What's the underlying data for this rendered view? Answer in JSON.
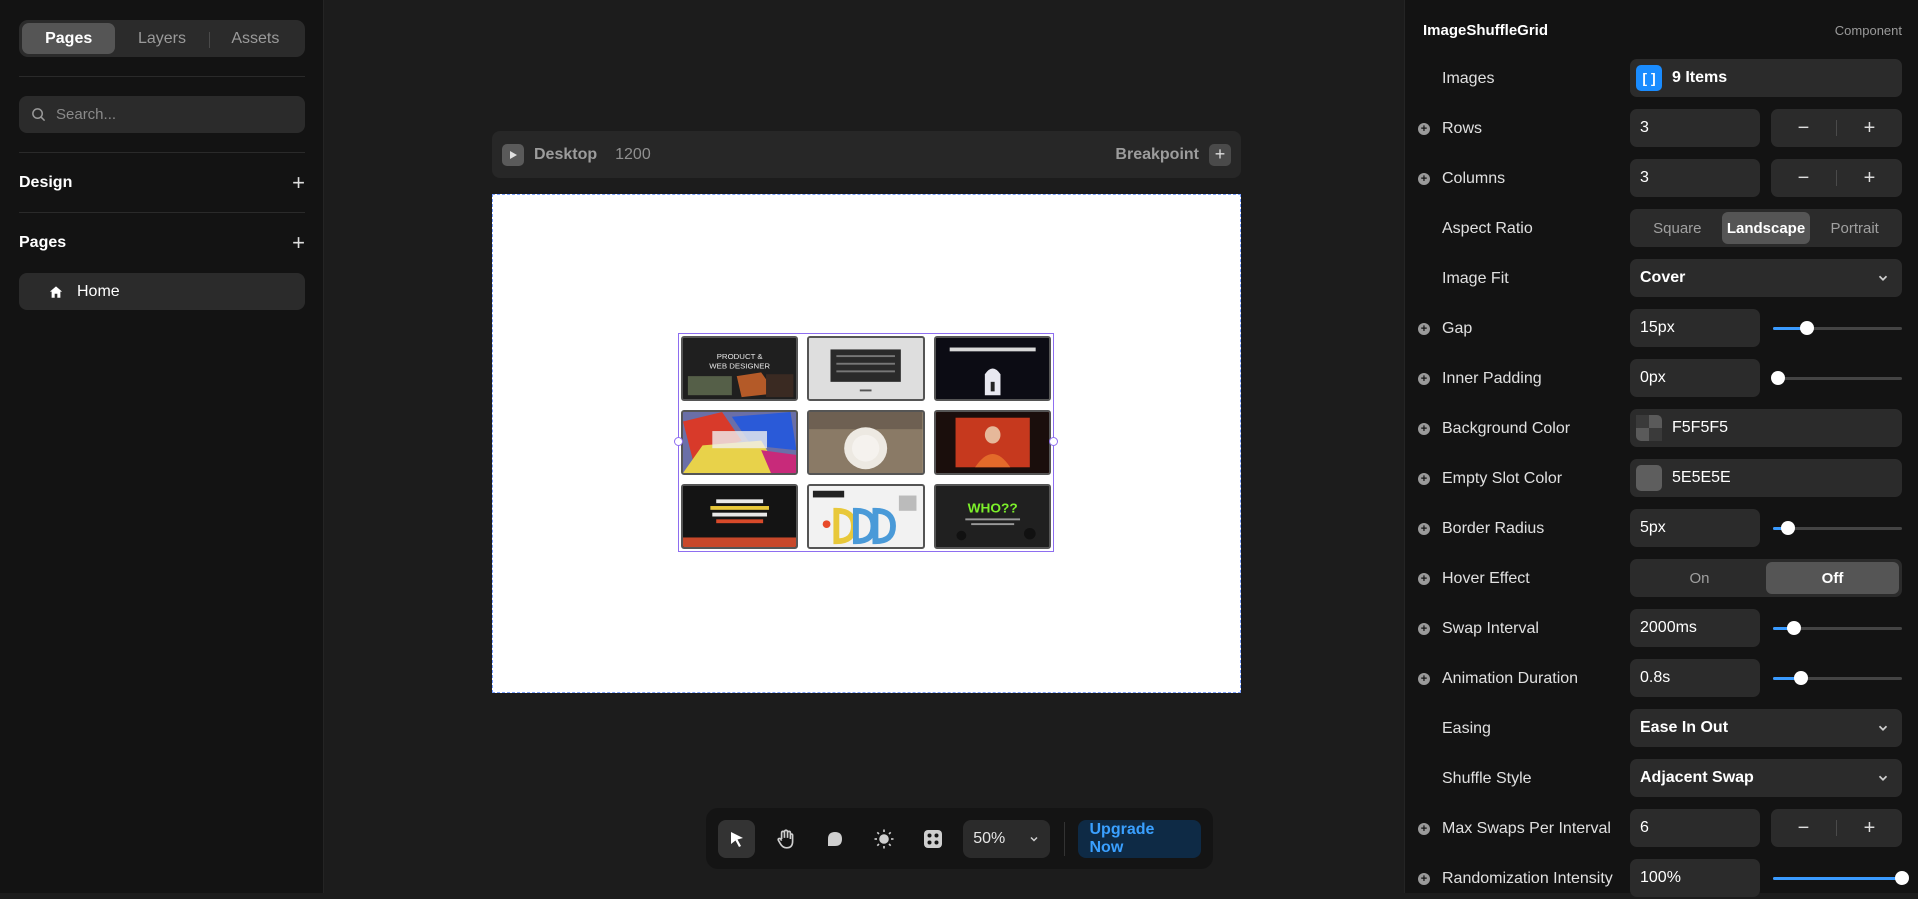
{
  "left_panel": {
    "tabs": [
      "Pages",
      "Layers",
      "Assets"
    ],
    "search_placeholder": "Search...",
    "design_label": "Design",
    "pages_label": "Pages",
    "page_items": [
      "Home"
    ]
  },
  "canvas": {
    "breakpoint_name": "Desktop",
    "breakpoint_width": "1200",
    "breakpoint_label": "Breakpoint",
    "frame_background": "#ffffff",
    "grid_selection_color": "#8e6ef0",
    "thumbnails": [
      {
        "name": "product-web-designer",
        "bg": "#1f1f1f",
        "text": "PRODUCT & WEB DESIGNER"
      },
      {
        "name": "gray-gallery",
        "bg": "#dcdcdc",
        "text": ""
      },
      {
        "name": "dark-arch",
        "bg": "#0c0c14",
        "text": ""
      },
      {
        "name": "colorful-collage",
        "bg": "#6b6b8a",
        "text": ""
      },
      {
        "name": "white-plate",
        "bg": "#9c8c76",
        "text": ""
      },
      {
        "name": "red-portrait",
        "bg": "#b0301e",
        "text": ""
      },
      {
        "name": "dark-type",
        "bg": "#151515",
        "text": ""
      },
      {
        "name": "diana-liu",
        "bg": "#f2f2f2",
        "text": "Diana.Liu"
      },
      {
        "name": "who-question",
        "bg": "#222222",
        "text": "WHO??"
      }
    ]
  },
  "toolbar": {
    "zoom": "50%",
    "upgrade_label": "Upgrade Now"
  },
  "properties": {
    "component_name": "ImageShuffleGrid",
    "component_tag": "Component",
    "images": {
      "label": "Images",
      "value": "9 Items"
    },
    "rows": {
      "label": "Rows",
      "value": "3"
    },
    "columns": {
      "label": "Columns",
      "value": "3"
    },
    "aspect_ratio": {
      "label": "Aspect Ratio",
      "options": [
        "Square",
        "Landscape",
        "Portrait"
      ],
      "selected": "Landscape"
    },
    "image_fit": {
      "label": "Image Fit",
      "value": "Cover"
    },
    "gap": {
      "label": "Gap",
      "value": "15px",
      "slider_fraction": 0.26
    },
    "inner_padding": {
      "label": "Inner Padding",
      "value": "0px",
      "slider_fraction": 0.04
    },
    "background_color": {
      "label": "Background Color",
      "value": "F5F5F5",
      "swatch": "#f5f5f5"
    },
    "empty_slot_color": {
      "label": "Empty Slot Color",
      "value": "5E5E5E",
      "swatch": "#5e5e5e"
    },
    "border_radius": {
      "label": "Border Radius",
      "value": "5px",
      "slider_fraction": 0.12
    },
    "hover_effect": {
      "label": "Hover Effect",
      "options": [
        "On",
        "Off"
      ],
      "selected": "Off"
    },
    "swap_interval": {
      "label": "Swap Interval",
      "value": "2000ms",
      "slider_fraction": 0.16
    },
    "animation_duration": {
      "label": "Animation Duration",
      "value": "0.8s",
      "slider_fraction": 0.22
    },
    "easing": {
      "label": "Easing",
      "value": "Ease In Out"
    },
    "shuffle_style": {
      "label": "Shuffle Style",
      "value": "Adjacent Swap"
    },
    "max_swaps": {
      "label": "Max Swaps Per Interval",
      "value": "6"
    },
    "randomization": {
      "label": "Randomization Intensity",
      "value": "100%",
      "slider_fraction": 1.0
    }
  }
}
